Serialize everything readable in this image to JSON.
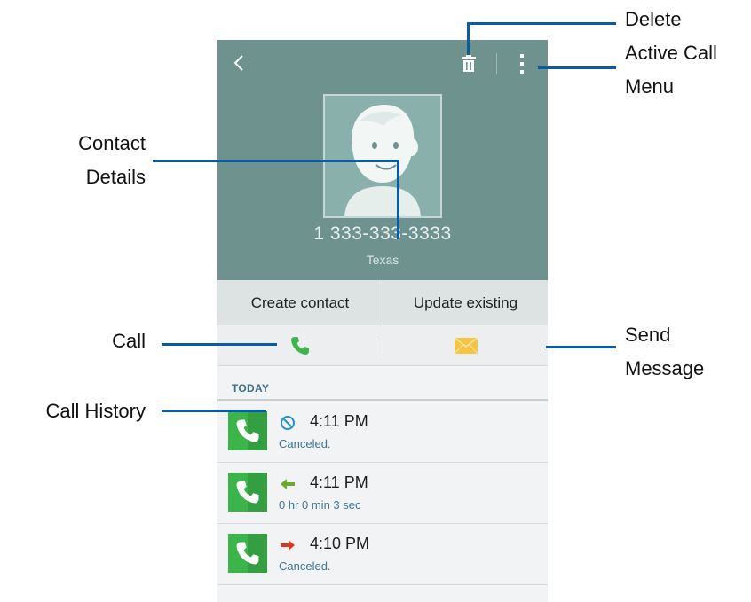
{
  "header": {
    "phone_number": "1 333-333-3333",
    "location": "Texas"
  },
  "actions": {
    "create_contact": "Create contact",
    "update_existing": "Update existing"
  },
  "history": {
    "section_title": "TODAY",
    "items": [
      {
        "time": "4:11 PM",
        "detail": "Canceled.",
        "type": "canceled",
        "icon": "blocked-icon",
        "icon_color": "#2a8fc8"
      },
      {
        "time": "4:11 PM",
        "detail": "0 hr 0 min 3 sec",
        "type": "incoming",
        "icon": "arrow-left-icon",
        "icon_color": "#6bab2b"
      },
      {
        "time": "4:10 PM",
        "detail": "Canceled.",
        "type": "outgoing",
        "icon": "arrow-right-icon",
        "icon_color": "#d7391f"
      }
    ]
  },
  "annotations": {
    "delete": "Delete",
    "active_call_menu_line1": "Active Call",
    "active_call_menu_line2": "Menu",
    "contact_details_line1": "Contact",
    "contact_details_line2": "Details",
    "call": "Call",
    "send_message_line1": "Send",
    "send_message_line2": "Message",
    "call_history": "Call History"
  },
  "colors": {
    "header_bg": "#6e928e",
    "call_green": "#3bb54a",
    "message_yellow": "#f6c342",
    "callout_blue": "#0b5aa5"
  }
}
